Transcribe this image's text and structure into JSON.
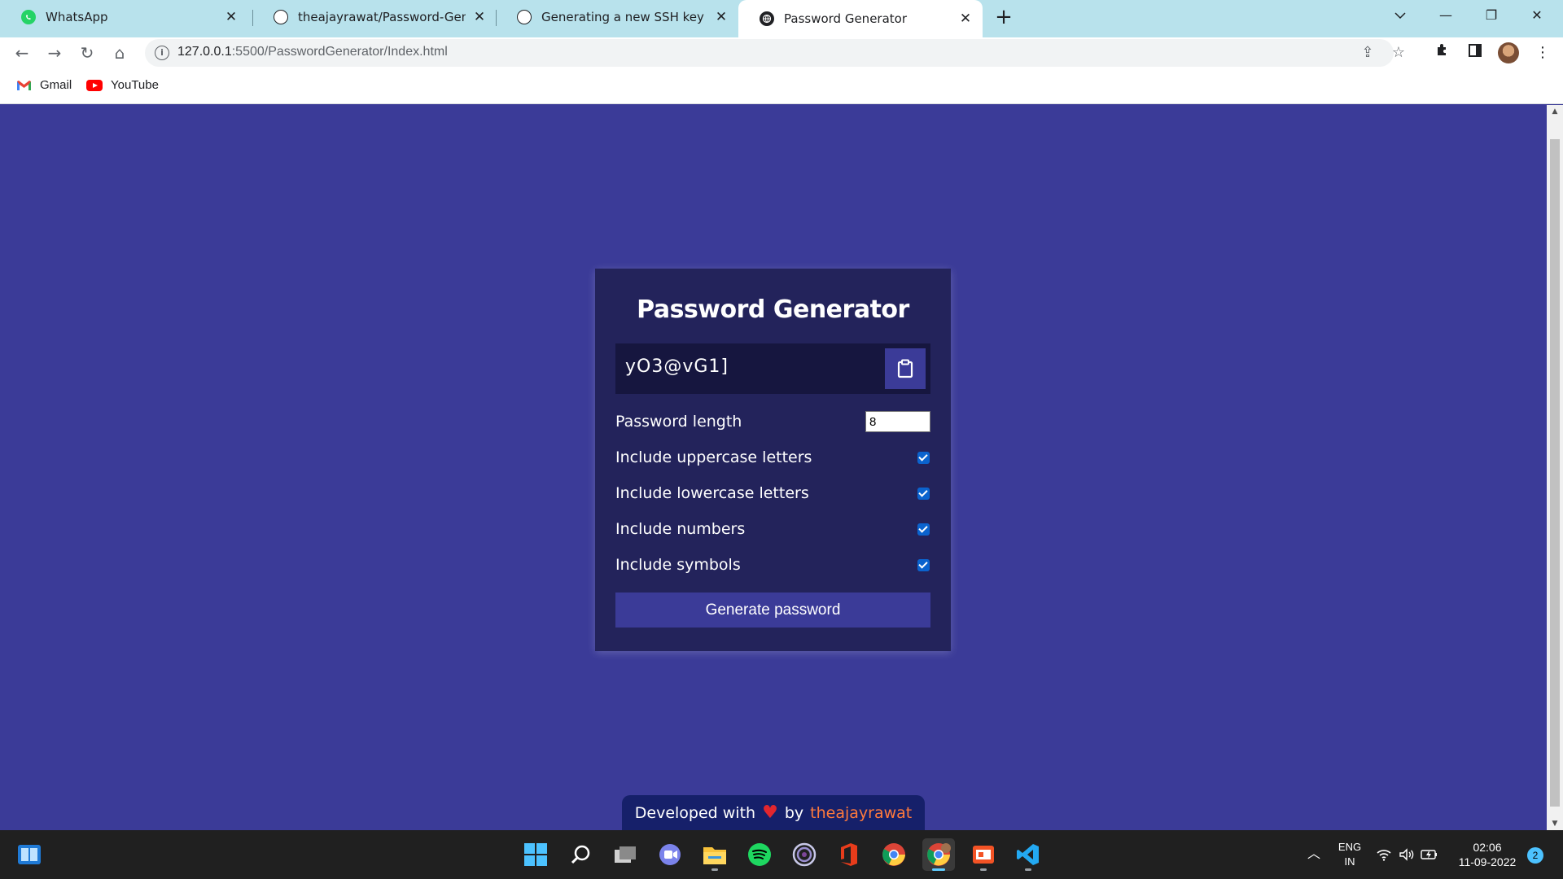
{
  "browser": {
    "tabs": [
      {
        "title": "WhatsApp",
        "icon": "whatsapp-icon",
        "active": false
      },
      {
        "title": "theajayrawat/Password-Generator",
        "icon": "github-icon",
        "active": false
      },
      {
        "title": "Generating a new SSH key and adding it to the ssh-agent",
        "icon": "github-icon",
        "active": false
      },
      {
        "title": "Password Generator",
        "icon": "globe-icon",
        "active": true
      }
    ],
    "url_host": "127.0.0.1",
    "url_path": ":5500/PasswordGenerator/Index.html",
    "bookmarks": [
      {
        "label": "Gmail",
        "icon": "gmail-icon"
      },
      {
        "label": "YouTube",
        "icon": "youtube-icon"
      }
    ]
  },
  "app": {
    "title": "Password Generator",
    "generated_password": "yO3@vG1]",
    "length_label": "Password length",
    "length_value": "8",
    "options": [
      {
        "label": "Include uppercase letters",
        "checked": true
      },
      {
        "label": "Include lowercase letters",
        "checked": true
      },
      {
        "label": "Include numbers",
        "checked": true
      },
      {
        "label": "Include symbols",
        "checked": true
      }
    ],
    "generate_label": "Generate password"
  },
  "footer": {
    "prefix": "Developed with",
    "by": "by",
    "author": "theajayrawat"
  },
  "taskbar": {
    "language_top": "ENG",
    "language_bottom": "IN",
    "time": "02:06",
    "date": "11-09-2022",
    "notifications": "2"
  },
  "colors": {
    "page_background": "#3b3b98",
    "card_background": "#23235b",
    "accent_author": "#ff7a3c"
  }
}
